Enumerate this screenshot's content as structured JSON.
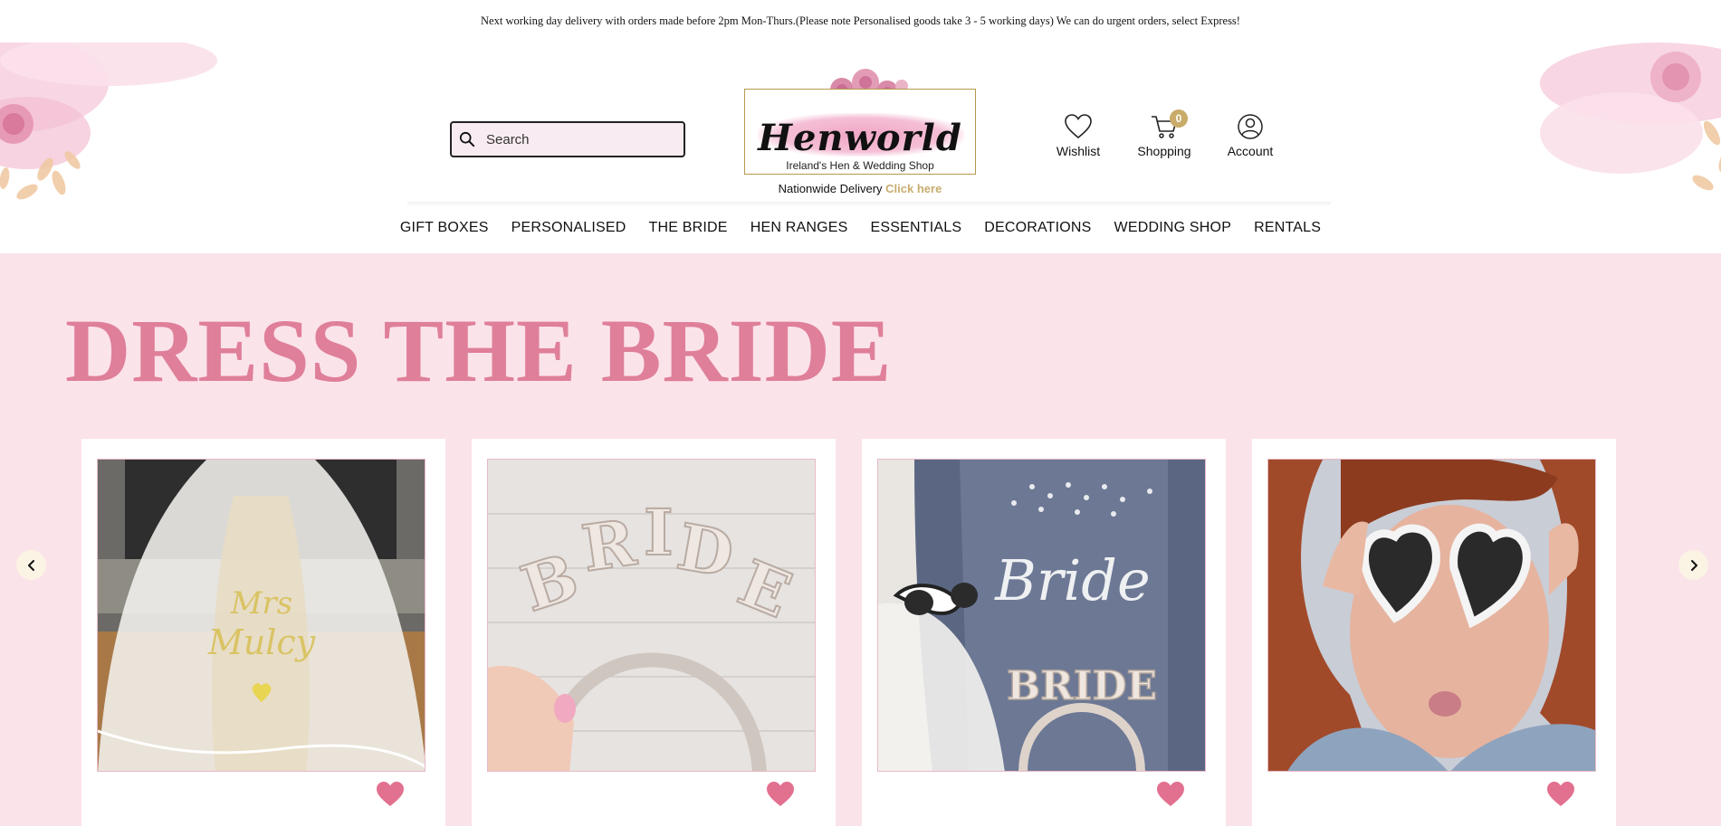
{
  "announcement": "Next working day delivery with orders made before 2pm Mon-Thurs.(Please note Personalised goods take 3 - 5 working days) We can do urgent orders, select Express!",
  "search": {
    "placeholder": "Search"
  },
  "logo": {
    "wordmark": "Henworld",
    "tagline": "Ireland's Hen & Wedding Shop"
  },
  "delivery": {
    "text": "Nationwide Delivery",
    "link": "Click here"
  },
  "header_icons": {
    "wishlist": {
      "label": "Wishlist",
      "icon": "heart-icon"
    },
    "shopping": {
      "label": "Shopping",
      "icon": "cart-icon",
      "count": "0"
    },
    "account": {
      "label": "Account",
      "icon": "user-icon"
    }
  },
  "nav": [
    "GIFT BOXES",
    "PERSONALISED",
    "THE BRIDE",
    "HEN RANGES",
    "ESSENTIALS",
    "DECORATIONS",
    "WEDDING SHOP",
    "RENTALS"
  ],
  "hero": {
    "title": "DRESS THE BRIDE"
  },
  "products": [
    {
      "image": "bride-veil-gold-lettering",
      "icon": "heart-icon"
    },
    {
      "image": "pearl-bride-headband",
      "icon": "heart-icon"
    },
    {
      "image": "bride-denim-jacket-with-headband",
      "icon": "heart-icon"
    },
    {
      "image": "woman-heart-sunglasses",
      "icon": "heart-icon"
    }
  ],
  "colors": {
    "accent_pink": "#df7f99",
    "hero_bg": "#fbe3ea",
    "gold": "#c7ad6e",
    "heart": "#e2708f"
  }
}
